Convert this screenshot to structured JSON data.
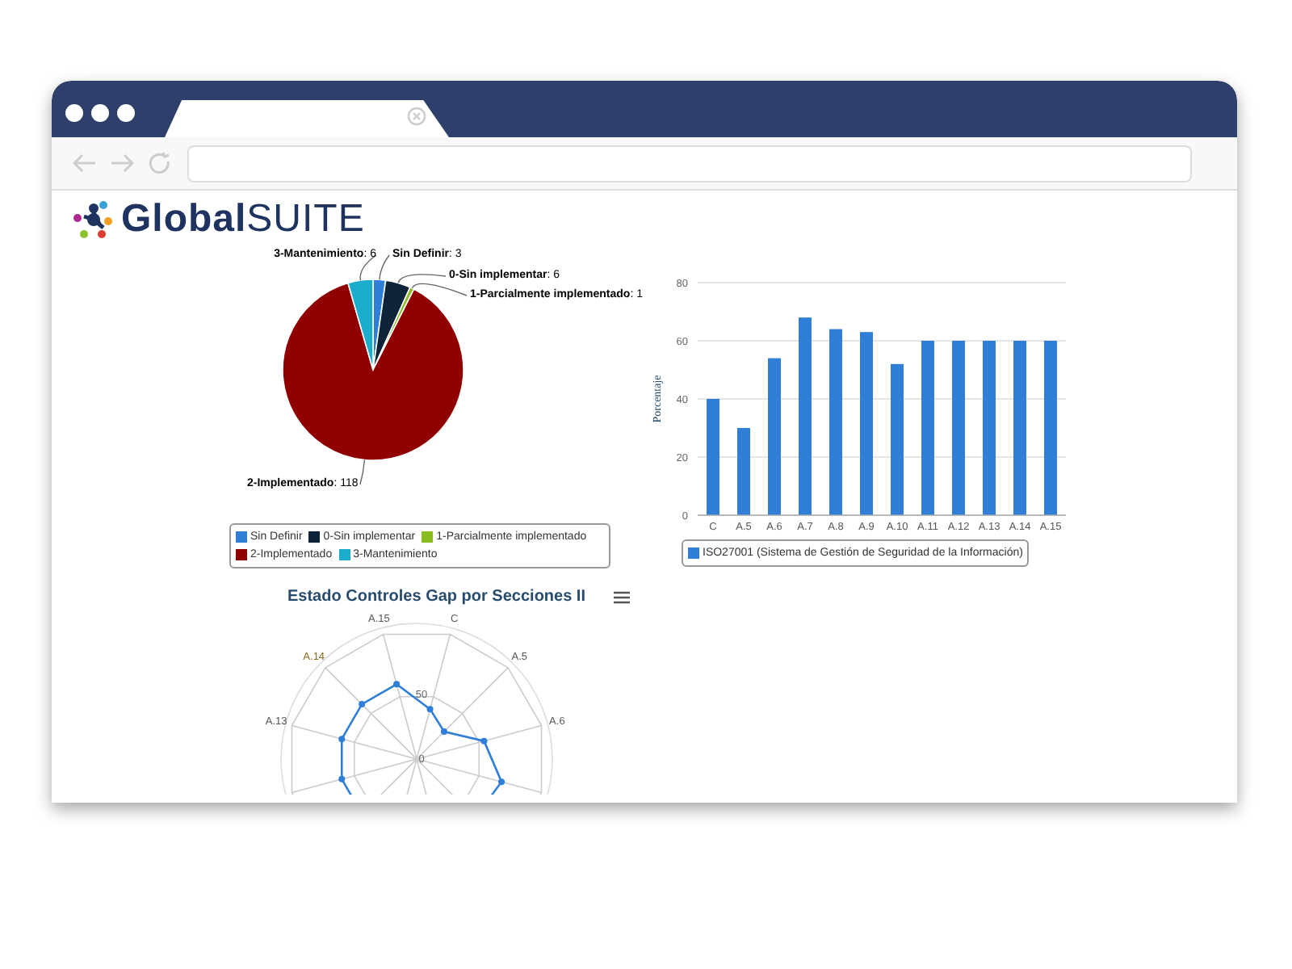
{
  "brand": {
    "logo_text": "**Global**SUITE"
  },
  "pie": {
    "chart_data": {
      "type": "pie",
      "categories": [
        "Sin Definir",
        "0-Sin implementar",
        "1-Parcialmente implementado",
        "2-Implementado",
        "3-Mantenimiento"
      ],
      "values": [
        3,
        6,
        1,
        118,
        6
      ],
      "colors": [
        "#2f7ed8",
        "#0d233a",
        "#8bbc21",
        "#910000",
        "#1aadce"
      ]
    },
    "labels": [
      "**3-Mantenimiento**: 6",
      "**Sin Definir**: 3",
      "**0-Sin implementar**: 6",
      "**1-Parcialmente implementado**: 1",
      "**2-Implementado**: 118"
    ]
  },
  "bar": {
    "chart_data": {
      "type": "bar",
      "ylabel": "Porcentaje",
      "categories": [
        "C",
        "A.5",
        "A.6",
        "A.7",
        "A.8",
        "A.9",
        "A.10",
        "A.11",
        "A.12",
        "A.13",
        "A.14",
        "A.15"
      ],
      "series": [
        {
          "name": "ISO27001 (Sistema de Gestión de Seguridad de la Información)",
          "color": "#2f7ed8",
          "values": [
            40,
            30,
            54,
            68,
            64,
            63,
            52,
            60,
            60,
            60,
            60,
            60
          ]
        }
      ],
      "ylim": [
        0,
        80
      ],
      "yticks": [
        0,
        20,
        40,
        60,
        80
      ],
      "grid": true
    }
  },
  "radar": {
    "title": "Estado Controles Gap por Secciones II",
    "axis_labels": [
      "A.15",
      "C",
      "A.14",
      "A.5",
      "A.13",
      "A.6"
    ],
    "ring_labels": [
      "50",
      "0"
    ]
  }
}
